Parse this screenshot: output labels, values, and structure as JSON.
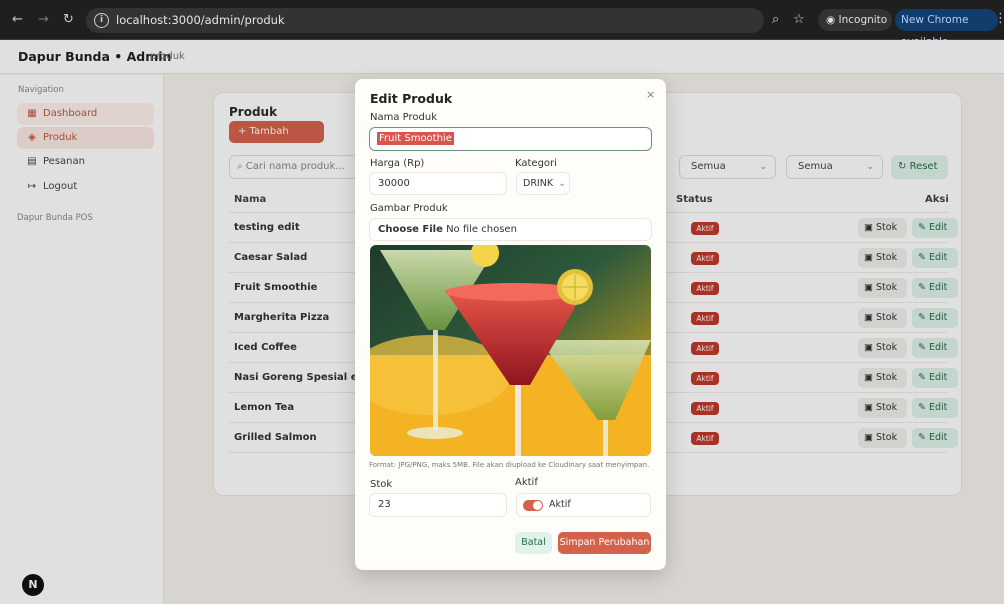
{
  "browser": {
    "url": "localhost:3000/admin/produk",
    "incognito_label": "Incognito",
    "update_label": "New Chrome available"
  },
  "app": {
    "brand": "Dapur Bunda • Admin",
    "breadcrumb": "produk"
  },
  "sidebar": {
    "caption": "Navigation",
    "items": [
      {
        "label": "Dashboard",
        "icon": "grid-icon"
      },
      {
        "label": "Produk",
        "icon": "box-icon"
      },
      {
        "label": "Pesanan",
        "icon": "clipboard-icon"
      },
      {
        "label": "Logout",
        "icon": "logout-icon"
      }
    ],
    "footer": "Dapur Bunda POS"
  },
  "card": {
    "title": "Produk",
    "add_label": "+ Tambah Produk",
    "search_placeholder": "Cari nama produk...",
    "filter_category": "Semua",
    "filter_status": "Semua",
    "reset_label": "Reset",
    "columns": {
      "name": "Nama",
      "status": "Status",
      "actions": "Aksi"
    },
    "status_label": "Aktif",
    "stok_label": "Stok",
    "edit_label": "Edit",
    "rows": [
      {
        "name": "testing edit"
      },
      {
        "name": "Caesar Salad"
      },
      {
        "name": "Fruit Smoothie"
      },
      {
        "name": "Margherita Pizza"
      },
      {
        "name": "Iced Coffee"
      },
      {
        "name": "Nasi Goreng Spesial edit"
      },
      {
        "name": "Lemon Tea"
      },
      {
        "name": "Grilled Salmon"
      }
    ]
  },
  "modal": {
    "title": "Edit Produk",
    "close": "×",
    "name_label": "Nama Produk",
    "name_value": "Fruit Smoothie",
    "price_label": "Harga (Rp)",
    "price_value": "30000",
    "category_label": "Kategori",
    "category_value": "DRINK",
    "image_label": "Gambar Produk",
    "file_button": "Choose File",
    "file_status": "No file chosen",
    "hint": "Format: JPG/PNG, maks 5MB. File akan diupload ke Cloudinary saat menyimpan.",
    "stock_label": "Stok",
    "stock_value": "23",
    "active_label": "Aktif",
    "active_toggle_label": "Aktif",
    "active": true,
    "cancel_label": "Batal",
    "save_label": "Simpan Perubahan"
  },
  "colors": {
    "accent": "#d4624a",
    "success_bg": "#dff3ea",
    "badge": "#c0392b"
  },
  "next_badge": "N"
}
